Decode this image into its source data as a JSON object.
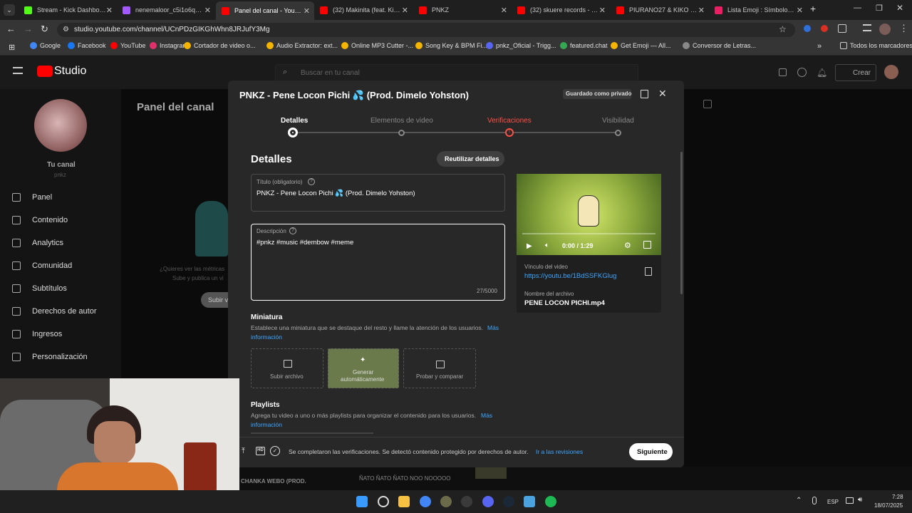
{
  "browser": {
    "tabs": [
      {
        "label": "Stream - Kick Dashboard",
        "color": "#53fc18"
      },
      {
        "label": "nenemaloor_c5i1o6qq.gif",
        "color": "#a259ff"
      },
      {
        "label": "Panel del canal - YouTube",
        "color": "#ff0000"
      },
      {
        "label": "(32) Makinita (feat. Kiko C",
        "color": "#ff0000"
      },
      {
        "label": "PNKZ",
        "color": "#ff0000"
      },
      {
        "label": "(32) skuere records - YouT",
        "color": "#ff0000"
      },
      {
        "label": "PIURANO27 & KIKO CHO",
        "color": "#ff0000"
      },
      {
        "label": "Lista Emoji : Símbolos em",
        "color": "#e91e63"
      }
    ],
    "url": "studio.youtube.com/channel/UCnPDzGIKGhWhn8JRJufY3Mg",
    "bookmarks": [
      "Google",
      "Facebook",
      "YouTube",
      "Instagram",
      "Cortador de video o...",
      "Audio Extractor: ext...",
      "Online MP3 Cutter -...",
      "Song Key & BPM Fi...",
      "pnkz_Oficial - Trigg...",
      "featured.chat",
      "Get Emoji — All...",
      "Conversor de Letras..."
    ],
    "all_bookmarks": "Todos los marcadores",
    "new_tab": "+",
    "more": "»"
  },
  "studio": {
    "logo": "Studio",
    "search_placeholder": "Buscar en tu canal",
    "create_label": "Crear",
    "channel_name": "Tu canal",
    "channel_handle": "pnkz",
    "nav": [
      "Panel",
      "Contenido",
      "Analytics",
      "Comunidad",
      "Subtítulos",
      "Derechos de autor",
      "Ingresos",
      "Personalización"
    ],
    "page_title": "Panel del canal",
    "bg_text1": "¿Quieres ver las métricas",
    "bg_text2": "Sube y publica un vi",
    "bg_button": "Subir vi",
    "bg_bottom1": "ÑATO ÑATO ÑATO NOO NOOOOO",
    "bg_bottom2": "CHANKA WEBO (PROD."
  },
  "modal": {
    "title": "PNKZ - Pene Locon Pichi 💦 (Prod. Dimelo Yohston)",
    "saved_badge": "Guardado como privado",
    "steps": [
      "Detalles",
      "Elementos de video",
      "Verificaciones",
      "Visibilidad"
    ],
    "section_title": "Detalles",
    "reuse_button": "Reutilizar detalles",
    "title_label": "Título (obligatorio)",
    "title_value": "PNKZ - Pene Locon Pichi 💦 (Prod. Dimelo Yohston)",
    "desc_label": "Descripción",
    "desc_value": "#pnkz #music #dembow #meme",
    "desc_counter": "27/5000",
    "thumb_title": "Miniatura",
    "thumb_desc": "Establece una miniatura que se destaque del resto y llame la atención de los usuarios.",
    "thumb_more": "Más información",
    "thumb_more_b": "información",
    "thumb_more_a": "Más",
    "tiles": [
      "Subir archivo",
      "Generar automáticamente",
      "Probar y comparar"
    ],
    "playlists_title": "Playlists",
    "playlists_desc": "Agrega tu video a uno o más playlists para organizar el contenido para los usuarios.",
    "video_time": "0:00 / 1:29",
    "video_link_label": "Vínculo del video",
    "video_link": "https://youtu.be/1BdSSFKGlug",
    "filename_label": "Nombre del archivo",
    "filename": "PENE LOCON PICHI.mp4",
    "status_text": "Se completaron las verificaciones. Se detectó contenido protegido por derechos de autor.",
    "status_link": "Ir a las revisiones",
    "next_button": "Siguiente",
    "hd_badge": "HD"
  },
  "taskbar": {
    "lang": "ESP",
    "time": "7:28",
    "date": "18/07/2025"
  },
  "colors": {
    "accent": "#3ea6ff",
    "warning": "#ff4e45",
    "bg": "#282828"
  }
}
